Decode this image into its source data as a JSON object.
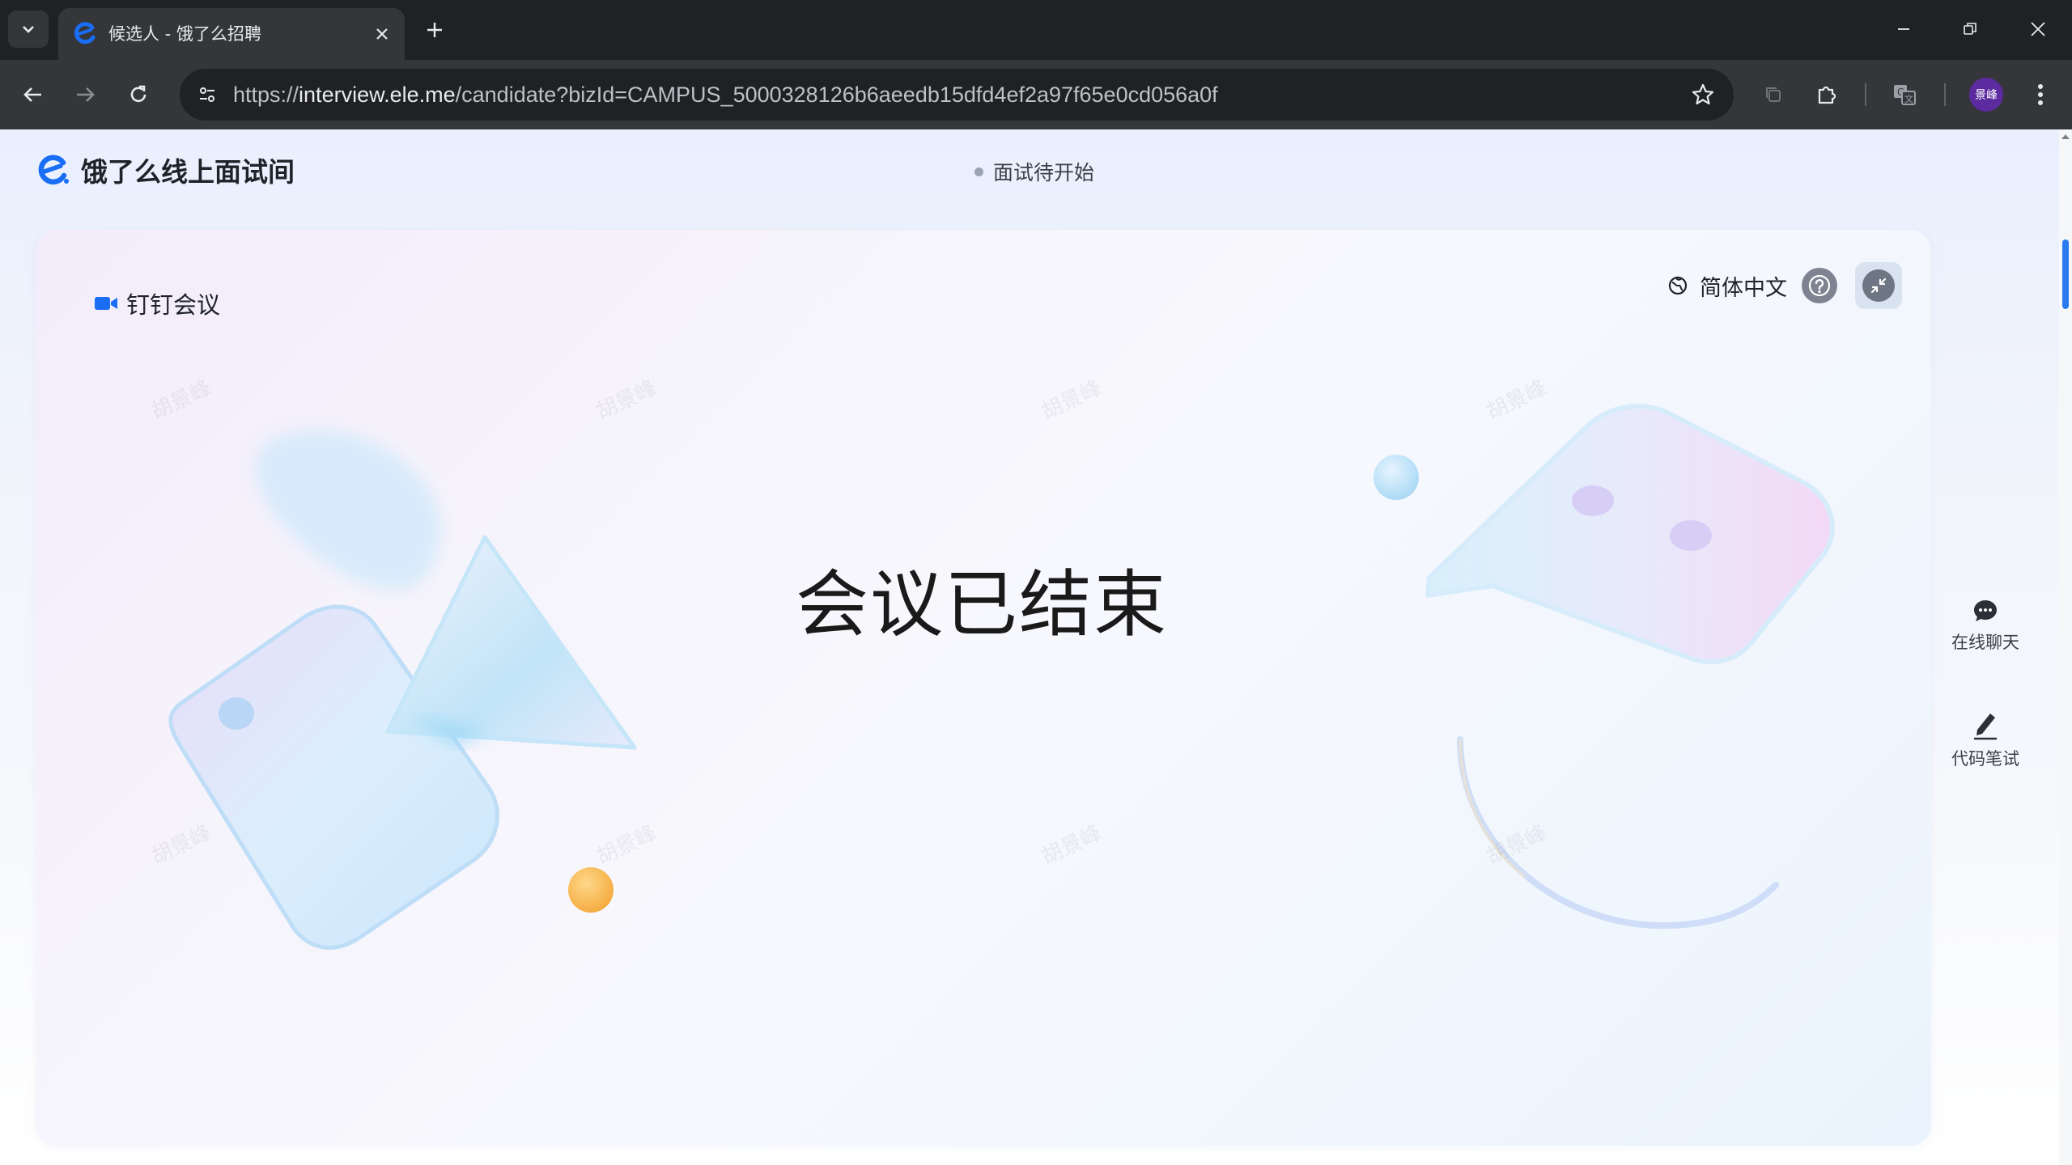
{
  "browser": {
    "tab": {
      "title": "候选人 - 饿了么招聘"
    },
    "url": {
      "scheme": "https://",
      "host": "interview.ele.me",
      "path": "/candidate?bizId=CAMPUS_5000328126b6aeedb15dfd4ef2a97f65e0cd056a0f"
    },
    "profile_initials": "景峰"
  },
  "header": {
    "brand_name": "饿了么线上面试间",
    "status_text": "面试待开始"
  },
  "card": {
    "meeting_label": "钉钉会议",
    "language_label": "简体中文",
    "ended_title": "会议已结束"
  },
  "side_tools": [
    {
      "label": "在线聊天",
      "icon": "chat-bubble-icon"
    },
    {
      "label": "代码笔试",
      "icon": "pencil-icon"
    }
  ],
  "watermark_text": "胡景峰",
  "colors": {
    "brand_blue": "#1a6ef5",
    "accent_orange": "#f5b13e",
    "chrome_dark": "#202124"
  }
}
